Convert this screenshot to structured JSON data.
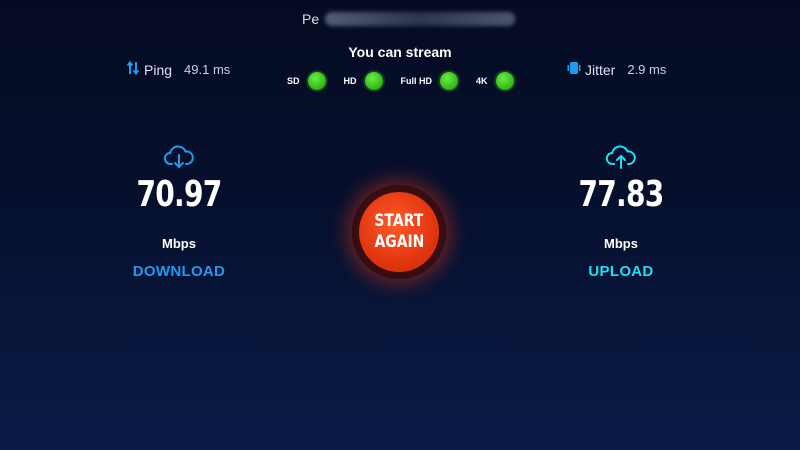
{
  "provider": {
    "prefix": "Pe"
  },
  "stream": {
    "title": "You can stream",
    "items": [
      {
        "label": "SD",
        "status_color": "#3ecb1f"
      },
      {
        "label": "HD",
        "status_color": "#3ecb1f"
      },
      {
        "label": "Full HD",
        "status_color": "#3ecb1f"
      },
      {
        "label": "4K",
        "status_color": "#3ecb1f"
      }
    ]
  },
  "ping": {
    "icon": "ping-arrows-icon",
    "label": "Ping",
    "value": "49.1 ms"
  },
  "jitter": {
    "icon": "jitter-icon",
    "label": "Jitter",
    "value": "2.9 ms"
  },
  "download": {
    "icon": "cloud-download-icon",
    "speed": "70.97",
    "unit": "Mbps",
    "label": "DOWNLOAD",
    "color": "#1e9bf0"
  },
  "upload": {
    "icon": "cloud-upload-icon",
    "speed": "77.83",
    "unit": "Mbps",
    "label": "UPLOAD",
    "color": "#1ee0f3"
  },
  "action": {
    "line1": "START",
    "line2": "AGAIN",
    "color": "#e2360f"
  }
}
